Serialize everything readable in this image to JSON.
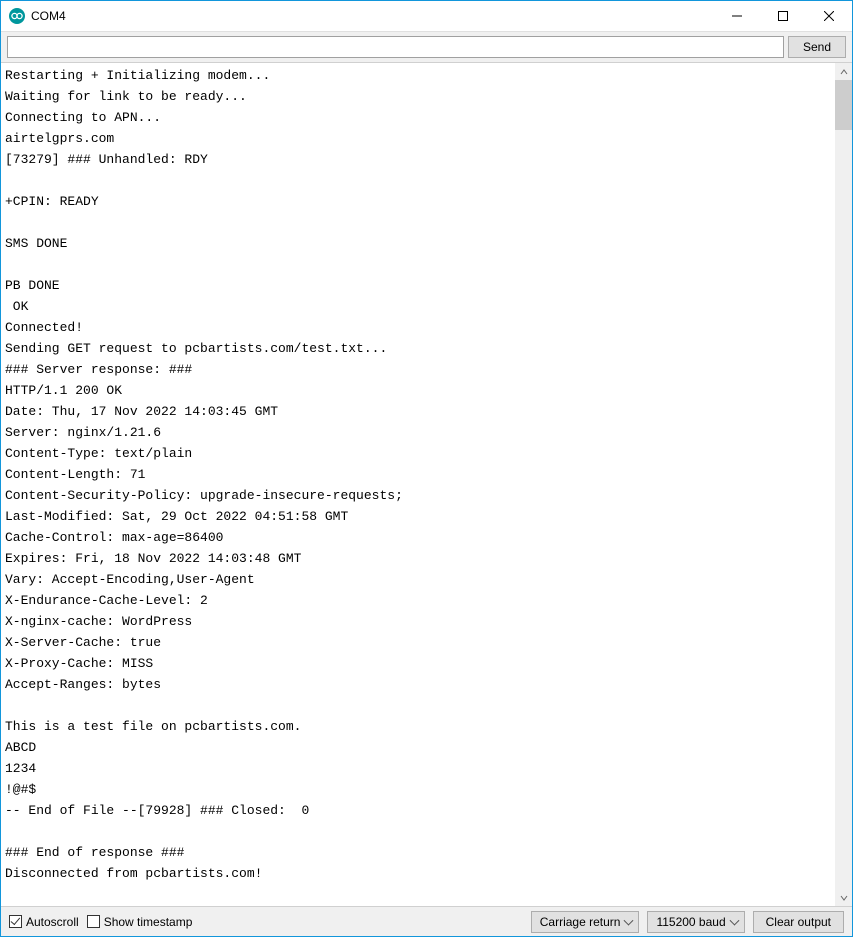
{
  "title": "COM4",
  "send_label": "Send",
  "input_value": "",
  "output": "Restarting + Initializing modem...\nWaiting for link to be ready...\nConnecting to APN...\nairtelgprs.com\n[73279] ### Unhandled: RDY\n\n+CPIN: READY\n\nSMS DONE\n\nPB DONE\n OK\nConnected!\nSending GET request to pcbartists.com/test.txt...\n### Server response: ###\nHTTP/1.1 200 OK\nDate: Thu, 17 Nov 2022 14:03:45 GMT\nServer: nginx/1.21.6\nContent-Type: text/plain\nContent-Length: 71\nContent-Security-Policy: upgrade-insecure-requests;\nLast-Modified: Sat, 29 Oct 2022 04:51:58 GMT\nCache-Control: max-age=86400\nExpires: Fri, 18 Nov 2022 14:03:48 GMT\nVary: Accept-Encoding,User-Agent\nX-Endurance-Cache-Level: 2\nX-nginx-cache: WordPress\nX-Server-Cache: true\nX-Proxy-Cache: MISS\nAccept-Ranges: bytes\n\nThis is a test file on pcbartists.com.\nABCD\n1234\n!@#$\n-- End of File --[79928] ### Closed:  0\n\n### End of response ###\nDisconnected from pcbartists.com!",
  "bottom": {
    "autoscroll_label": "Autoscroll",
    "autoscroll_checked": true,
    "timestamp_label": "Show timestamp",
    "timestamp_checked": false,
    "line_ending": "Carriage return",
    "baud": "115200 baud",
    "clear_label": "Clear output"
  }
}
